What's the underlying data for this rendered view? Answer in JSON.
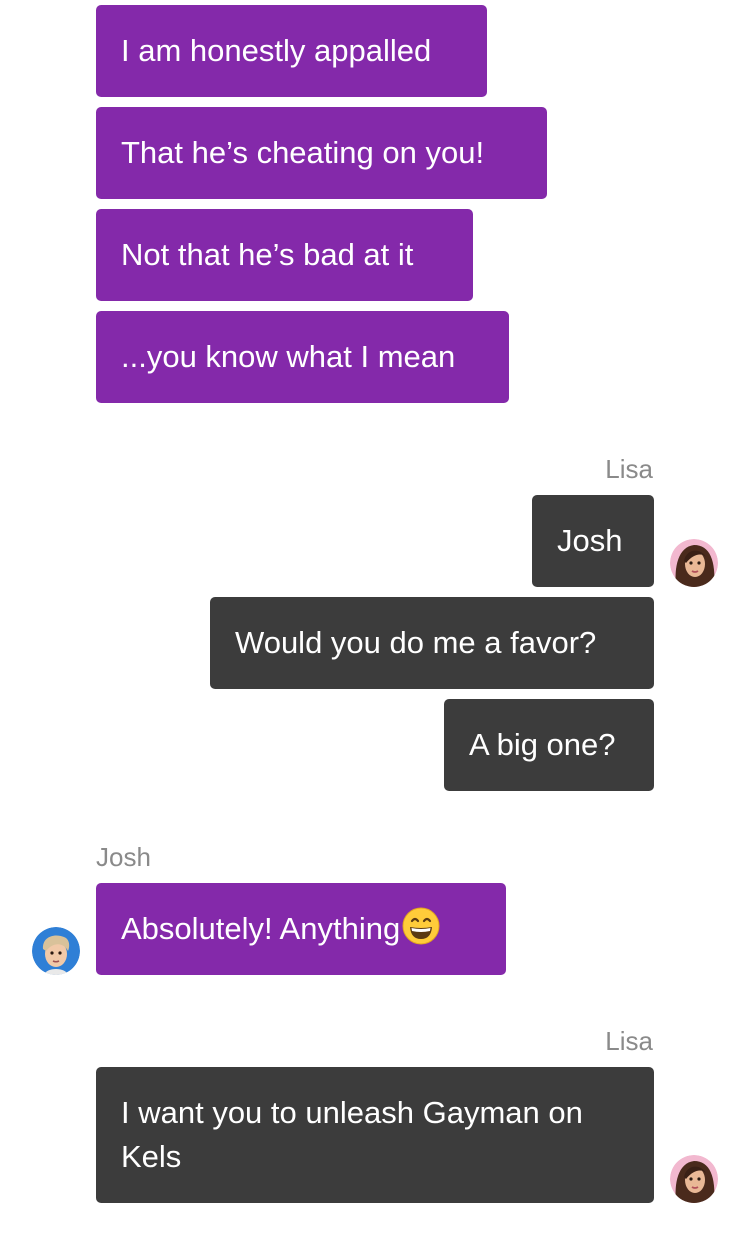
{
  "messages": {
    "m1": "I am honestly appalled",
    "m2": "That he’s cheating on you!",
    "m3": "Not that he’s bad at it",
    "m4": "...you know what I mean",
    "lisa_name_1": "Lisa",
    "m5": "Josh",
    "m6": "Would you do me a favor?",
    "m7": "A big one?",
    "josh_name": "Josh",
    "m8": "Absolutely! Anything",
    "lisa_name_2": "Lisa",
    "m9": "I want you to unleash Gayman on Kels"
  },
  "colors": {
    "josh_bubble": "#8429aa",
    "lisa_bubble": "#3c3c3c",
    "sender_name": "#8a8a8a"
  },
  "icons": {
    "lisa_avatar": "lisa-avatar-icon",
    "josh_avatar": "josh-avatar-icon",
    "emoji": "grinning-face-emoji-icon"
  }
}
